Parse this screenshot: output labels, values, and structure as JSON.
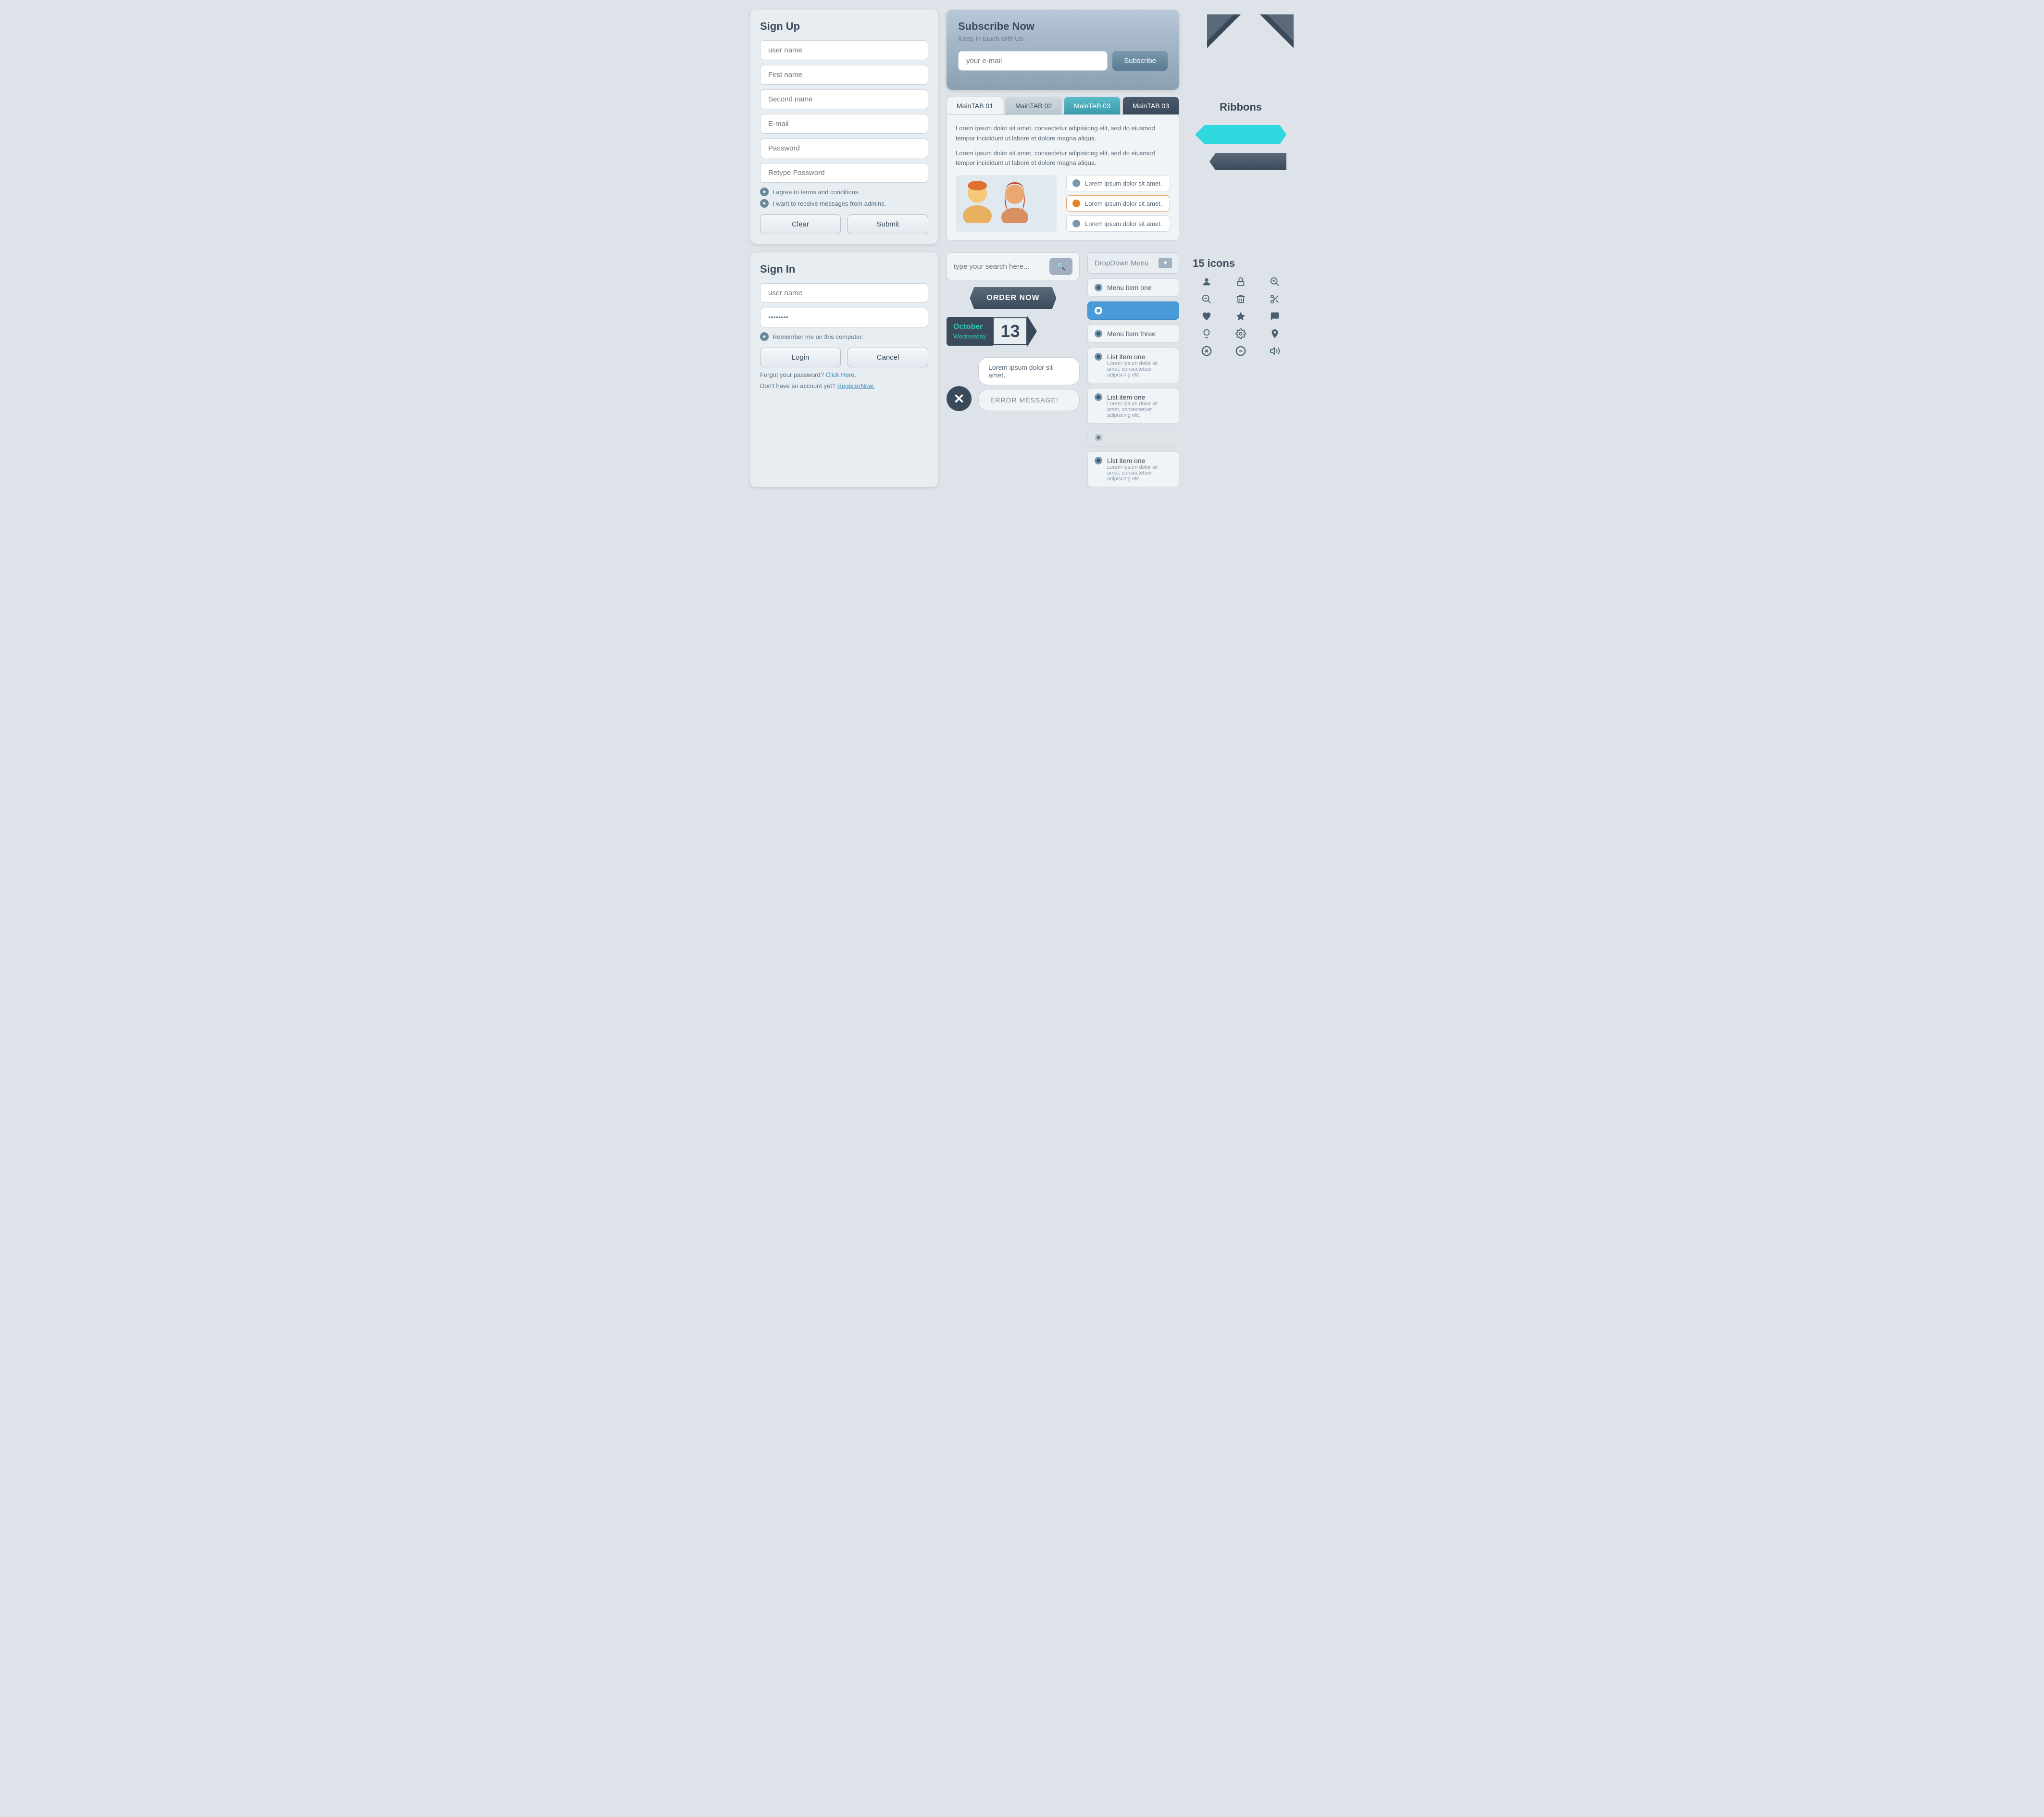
{
  "signup": {
    "title": "Sign Up",
    "fields": {
      "username": {
        "placeholder": "user name"
      },
      "firstname": {
        "placeholder": "First name"
      },
      "secondname": {
        "placeholder": "Second name"
      },
      "email": {
        "placeholder": "E-mail"
      },
      "password": {
        "placeholder": "Password"
      },
      "retype": {
        "placeholder": "Retype Password"
      }
    },
    "checkboxes": [
      "I agree to terms and conditions.",
      "I want to receive messages from admins."
    ],
    "buttons": {
      "clear": "Clear",
      "submit": "Submit"
    }
  },
  "subscribe": {
    "title": "Subscribe Now",
    "subtitle": "Keep in touch with Us.",
    "email_placeholder": "your e-mail",
    "button": "Subscribe"
  },
  "tabs": {
    "items": [
      {
        "label": "MainTAB 01",
        "state": "active"
      },
      {
        "label": "MainTAB 02",
        "state": "normal"
      },
      {
        "label": "MainTAB 03",
        "state": "teal"
      },
      {
        "label": "MainTAB 03",
        "state": "dark"
      }
    ],
    "content": "Lorem ipsum dolor sit amet, consectetur adipisicing elit, sed do eiusmod tempor incididunt ut labore et dolore magna aliqua.",
    "content2": "Lorem ipsum dolor sit amet, consectetur adipisicing elit, sed do eiusmod tempor incididunt ut labore et dolore magna aliqua.",
    "list_items": [
      "Lorem ipsum dolor sit amet.",
      "Lorem ipsum dolor sit amet.",
      "Lorem ipsum dolor sit amet."
    ]
  },
  "ribbons": {
    "title": "Ribbons"
  },
  "icons": {
    "title": "15 icons",
    "items": [
      "👤",
      "🔒",
      "🔍",
      "🗑",
      "✂",
      "🔍",
      "♥",
      "★",
      "💬",
      "💡",
      "⚙",
      "📍",
      "✕",
      "➖",
      "🔊"
    ]
  },
  "signin": {
    "title": "Sign In",
    "fields": {
      "username": {
        "placeholder": "user name"
      },
      "password": {
        "value": "********"
      }
    },
    "remember": "Remember me on this computer.",
    "buttons": {
      "login": "Login",
      "cancel": "Cancel"
    },
    "forgot": "Forgot your password?",
    "forgot_link": "Click Here.",
    "register": "Don't have an account yet?",
    "register_link": "RegisterNow."
  },
  "search": {
    "placeholder": "type your search here..."
  },
  "order": {
    "label": "ORDER NOW"
  },
  "date": {
    "month": "October",
    "day": "Wednesday",
    "number": "13"
  },
  "speech": {
    "top": "Lorem ipsum dolor sit amet,",
    "bottom": "ERROR MESSAGE!"
  },
  "dropdown": {
    "label": "DropDown Menu",
    "items": [
      {
        "label": "Menu item  one",
        "selected": false
      },
      {
        "label": "",
        "selected": true
      },
      {
        "label": "Menu item three",
        "selected": false
      }
    ],
    "list": [
      {
        "title": "List item one",
        "sub": "Lorem ipsum dolor sit amet, consectetuer adipiscing elit.",
        "disabled": false
      },
      {
        "title": "List item one",
        "sub": "Lorem ipsum dolor sit amet, consectetuer adipiscing elit.",
        "disabled": false
      },
      {
        "title": "",
        "sub": "",
        "disabled": true
      },
      {
        "title": "List item one",
        "sub": "Lorem ipsum dolor sit amet, consectetuer adipiscing elit.",
        "disabled": false
      }
    ]
  }
}
